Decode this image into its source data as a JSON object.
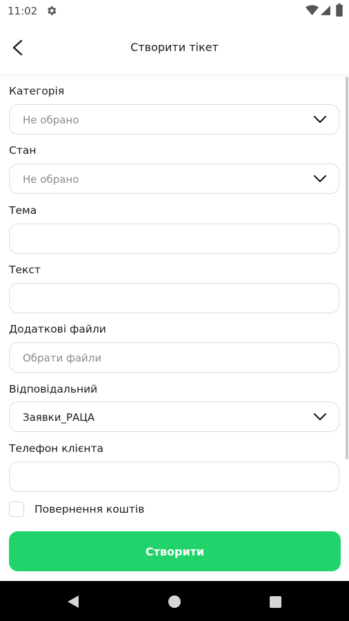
{
  "status_bar": {
    "time": "11:02",
    "icons": [
      "gear-icon",
      "wifi-icon",
      "signal-icon",
      "battery-icon"
    ]
  },
  "app_bar": {
    "title": "Створити тікет",
    "back_icon": "chevron-left-icon"
  },
  "form": {
    "category": {
      "label": "Категорія",
      "placeholder": "Не обрано"
    },
    "state": {
      "label": "Стан",
      "placeholder": "Не обрано"
    },
    "subject": {
      "label": "Тема",
      "value": ""
    },
    "text": {
      "label": "Текст",
      "value": ""
    },
    "files": {
      "label": "Додаткові файли",
      "placeholder": "Обрати файли"
    },
    "responsible": {
      "label": "Відповідальний",
      "value": "Заявки_РАЦА"
    },
    "client_phone": {
      "label": "Телефон клієнта",
      "value": ""
    },
    "refund": {
      "label": "Повернення коштів",
      "checked": false
    },
    "submit_label": "Створити"
  },
  "colors": {
    "accent": "#22d36b",
    "field_border": "#dcdcdc",
    "placeholder": "#8a8a8a"
  }
}
